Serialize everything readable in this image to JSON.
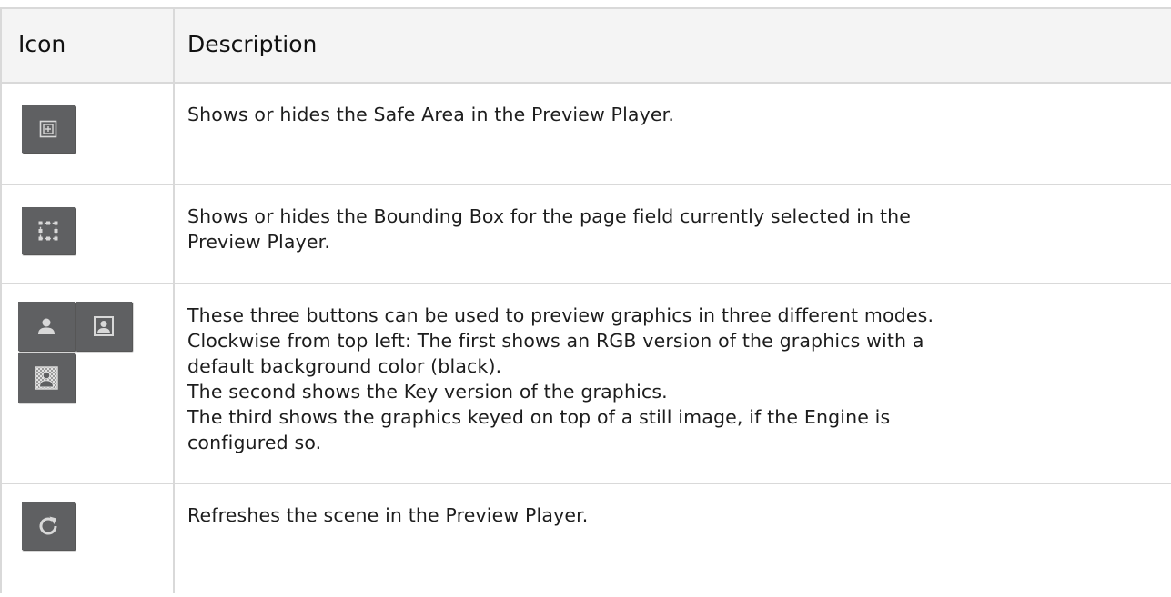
{
  "table": {
    "headers": {
      "icon": "Icon",
      "description": "Description"
    },
    "rows": [
      {
        "icon": "safe-area-icon",
        "lines": [
          "Shows or hides the Safe Area in the Preview Player."
        ]
      },
      {
        "icon": "bounding-box-icon",
        "lines": [
          "Shows or hides the Bounding Box for the page field currently selected in the",
          "Preview Player."
        ]
      },
      {
        "icons": [
          "rgb-preview-icon",
          "key-preview-icon",
          "still-image-preview-icon"
        ],
        "lines": [
          "These three buttons can be used to preview graphics in three different modes.",
          "Clockwise from top left: The first shows an RGB version of the graphics with a",
          "default background color (black).",
          "The second shows the Key version of the graphics.",
          "The third shows the graphics keyed on top of a still image, if the Engine is",
          "configured so."
        ]
      },
      {
        "icon": "refresh-icon",
        "lines": [
          "Refreshes the scene in the Preview Player."
        ]
      }
    ]
  },
  "colors": {
    "icon_button_bg": "#5f6062",
    "icon_glyph": "#d8d8d8",
    "border": "#d9d9d9",
    "header_bg": "#f4f4f4"
  }
}
